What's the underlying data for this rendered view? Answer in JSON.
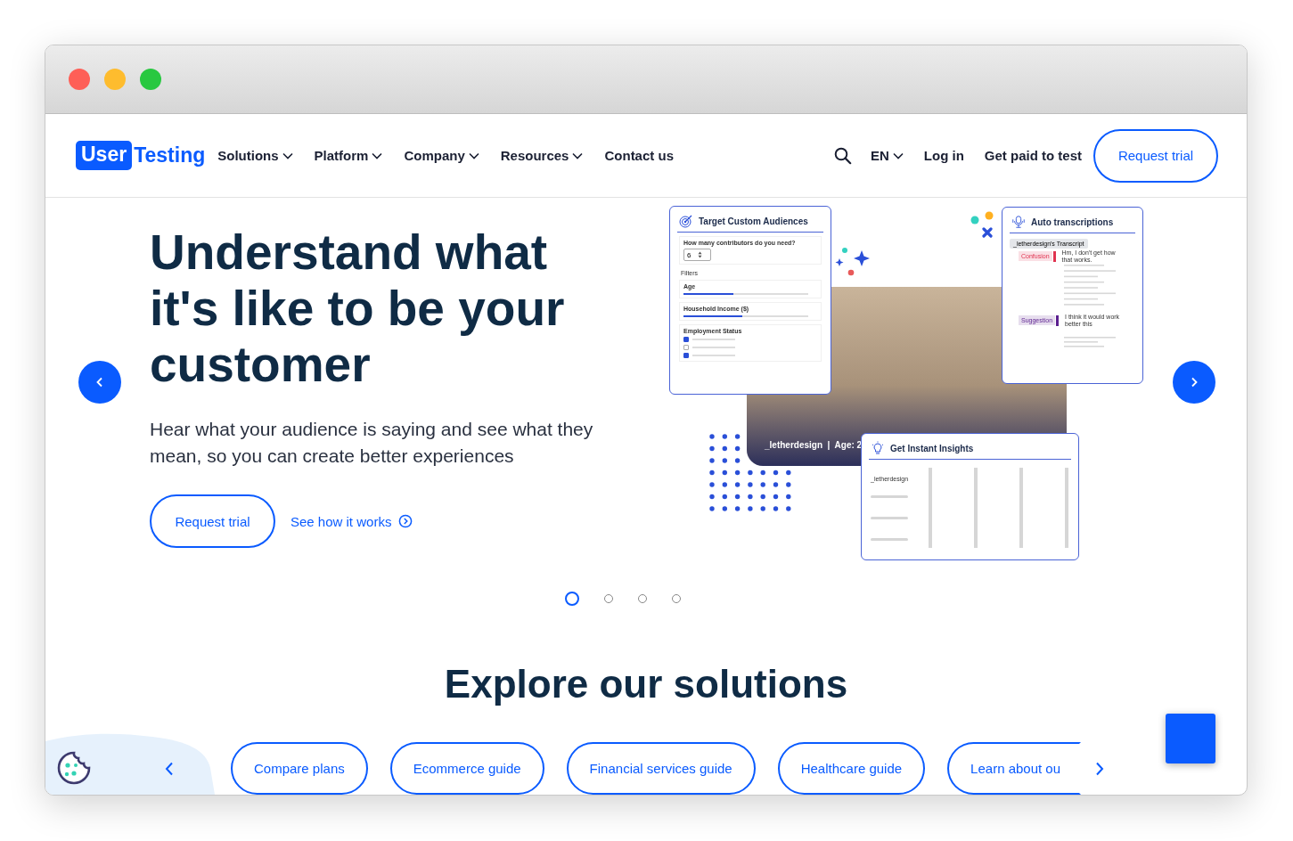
{
  "nav": {
    "logo": {
      "boxed": "User",
      "plain": "Testing"
    },
    "menu": [
      {
        "label": "Solutions",
        "dropdown": true
      },
      {
        "label": "Platform",
        "dropdown": true
      },
      {
        "label": "Company",
        "dropdown": true
      },
      {
        "label": "Resources",
        "dropdown": true
      },
      {
        "label": "Contact us",
        "dropdown": false
      }
    ],
    "language": "EN",
    "login": "Log in",
    "get_paid": "Get paid to test",
    "cta": "Request trial"
  },
  "hero": {
    "title": "Understand what it's like to be your customer",
    "subtitle": "Hear what your audience is saying and see what they mean, so you can create better experiences",
    "primary": "Request trial",
    "secondary": "See how it works",
    "illustration": {
      "audiences": {
        "title": "Target Custom Audiences",
        "question": "How many contributors do you need?",
        "count": "6",
        "filters_label": "Filters",
        "filters": [
          {
            "label": "Age",
            "level": 0.4
          },
          {
            "label": "Household Income ($)",
            "level": 0.47
          }
        ],
        "employment": {
          "label": "Employment Status",
          "options": [
            {
              "checked": true
            },
            {
              "checked": false
            },
            {
              "checked": true
            }
          ]
        }
      },
      "video_caption": "_letherdesign  |  Age: 2",
      "transcript": {
        "title": "Auto transcriptions",
        "tab": "_letherdesign's Transcript",
        "tags": [
          {
            "label": "Confusion",
            "quote": "Hm, I don't get how that works.",
            "color": "#e0324f"
          },
          {
            "label": "Suggestion",
            "quote": "I think it would work better this",
            "color": "#5b1f8f"
          }
        ]
      },
      "insights": {
        "title": "Get Instant Insights",
        "name": "_letherdesign"
      }
    }
  },
  "carousel": [
    {
      "selected": true
    },
    {
      "selected": false
    },
    {
      "selected": false
    },
    {
      "selected": false
    }
  ],
  "solutions": {
    "title": "Explore our solutions",
    "chips": [
      "Compare plans",
      "Ecommerce guide",
      "Financial services guide",
      "Healthcare guide",
      "Learn about ou"
    ]
  }
}
